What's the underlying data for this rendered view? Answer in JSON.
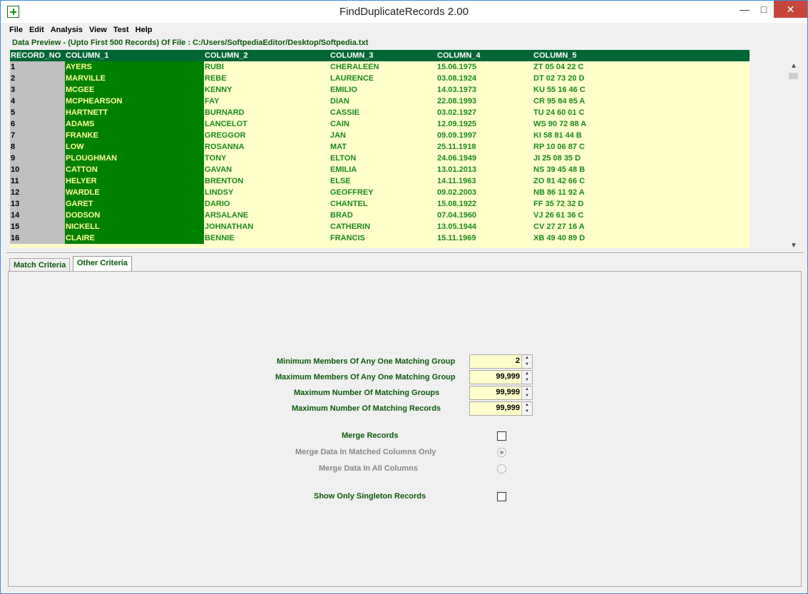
{
  "window": {
    "title": "FindDuplicateRecords 2.00",
    "min_glyph": "—",
    "max_glyph": "□",
    "close_glyph": "✕"
  },
  "menu": [
    "File",
    "Edit",
    "Analysis",
    "View",
    "Test",
    "Help"
  ],
  "preview": {
    "label": "Data Preview - (Upto First 500 Records) Of File  : C:/Users/SoftpediaEditor/Desktop/Softpedia.txt",
    "columns": [
      "RECORD_NO",
      "COLUMN_1",
      "COLUMN_2",
      "COLUMN_3",
      "COLUMN_4",
      "COLUMN_5"
    ],
    "rows": [
      [
        "1",
        "AYERS",
        "RUBI",
        "CHERALEEN",
        "15.06.1975",
        "ZT 05 04 22 C"
      ],
      [
        "2",
        "MARVILLE",
        "REBE",
        "LAURENCE",
        "03.08.1924",
        "DT 02 73 20 D"
      ],
      [
        "3",
        "MCGEE",
        "KENNY",
        "EMILIO",
        "14.03.1973",
        "KU 55 16 46 C"
      ],
      [
        "4",
        "MCPHEARSON",
        "FAY",
        "DIAN",
        "22.08.1993",
        "CR 95 84 85 A"
      ],
      [
        "5",
        "HARTNETT",
        "BURNARD",
        "CASSIE",
        "03.02.1927",
        "TU 24 60 01 C"
      ],
      [
        "6",
        "ADAMS",
        "LANCELOT",
        "CAIN",
        "12.09.1925",
        "WS 90 72 88 A"
      ],
      [
        "7",
        "FRANKE",
        "GREGGOR",
        "JAN",
        "09.09.1997",
        "KI 58 81 44 B"
      ],
      [
        "8",
        "LOW",
        "ROSANNA",
        "MAT",
        "25.11.1918",
        "RP 10 06 87 C"
      ],
      [
        "9",
        "PLOUGHMAN",
        "TONY",
        "ELTON",
        "24.06.1949",
        "JI 25 08 35 D"
      ],
      [
        "10",
        "CATTON",
        "GAVAN",
        "EMILIA",
        "13.01.2013",
        "NS 39 45 48 B"
      ],
      [
        "11",
        "HELYER",
        "BRENTON",
        "ELSE",
        "14.11.1963",
        "ZO 81 42 66 C"
      ],
      [
        "12",
        "WARDLE",
        "LINDSY",
        "GEOFFREY",
        "09.02.2003",
        "NB 86 11 92 A"
      ],
      [
        "13",
        "GARET",
        "DARIO",
        "CHANTEL",
        "15.08.1922",
        "FF 35 72 32 D"
      ],
      [
        "14",
        "DODSON",
        "ARSALANE",
        "BRAD",
        "07.04.1960",
        "VJ 26 61 36 C"
      ],
      [
        "15",
        "NICKELL",
        "JOHNATHAN",
        "CATHERIN",
        "13.05.1944",
        "CV 27 27 16 A"
      ],
      [
        "16",
        "CLAIRE",
        "BENNIE",
        "FRANCIS",
        "15.11.1969",
        "XB 49 40 89 D"
      ]
    ]
  },
  "tabs": [
    "Match Criteria",
    "Other Criteria"
  ],
  "active_tab": "Other Criteria",
  "other_criteria": {
    "min_members_label": "Minimum Members Of Any One Matching Group",
    "min_members_value": "2",
    "max_members_label": "Maximum Members Of Any One Matching Group",
    "max_members_value": "99,999",
    "max_groups_label": "Maximum Number Of Matching Groups",
    "max_groups_value": "99,999",
    "max_records_label": "Maximum Number Of Matching Records",
    "max_records_value": "99,999",
    "merge_records_label": "Merge Records",
    "merge_records_checked": false,
    "merge_matched_label": "Merge Data In Matched Columns Only",
    "merge_matched_selected": true,
    "merge_all_label": "Merge Data In All Columns",
    "merge_all_selected": false,
    "singleton_label": "Show Only Singleton Records",
    "singleton_checked": false
  },
  "icons": {
    "spin_up": "▲",
    "spin_down": "▼",
    "scroll_up": "▲",
    "scroll_down": "▼"
  }
}
